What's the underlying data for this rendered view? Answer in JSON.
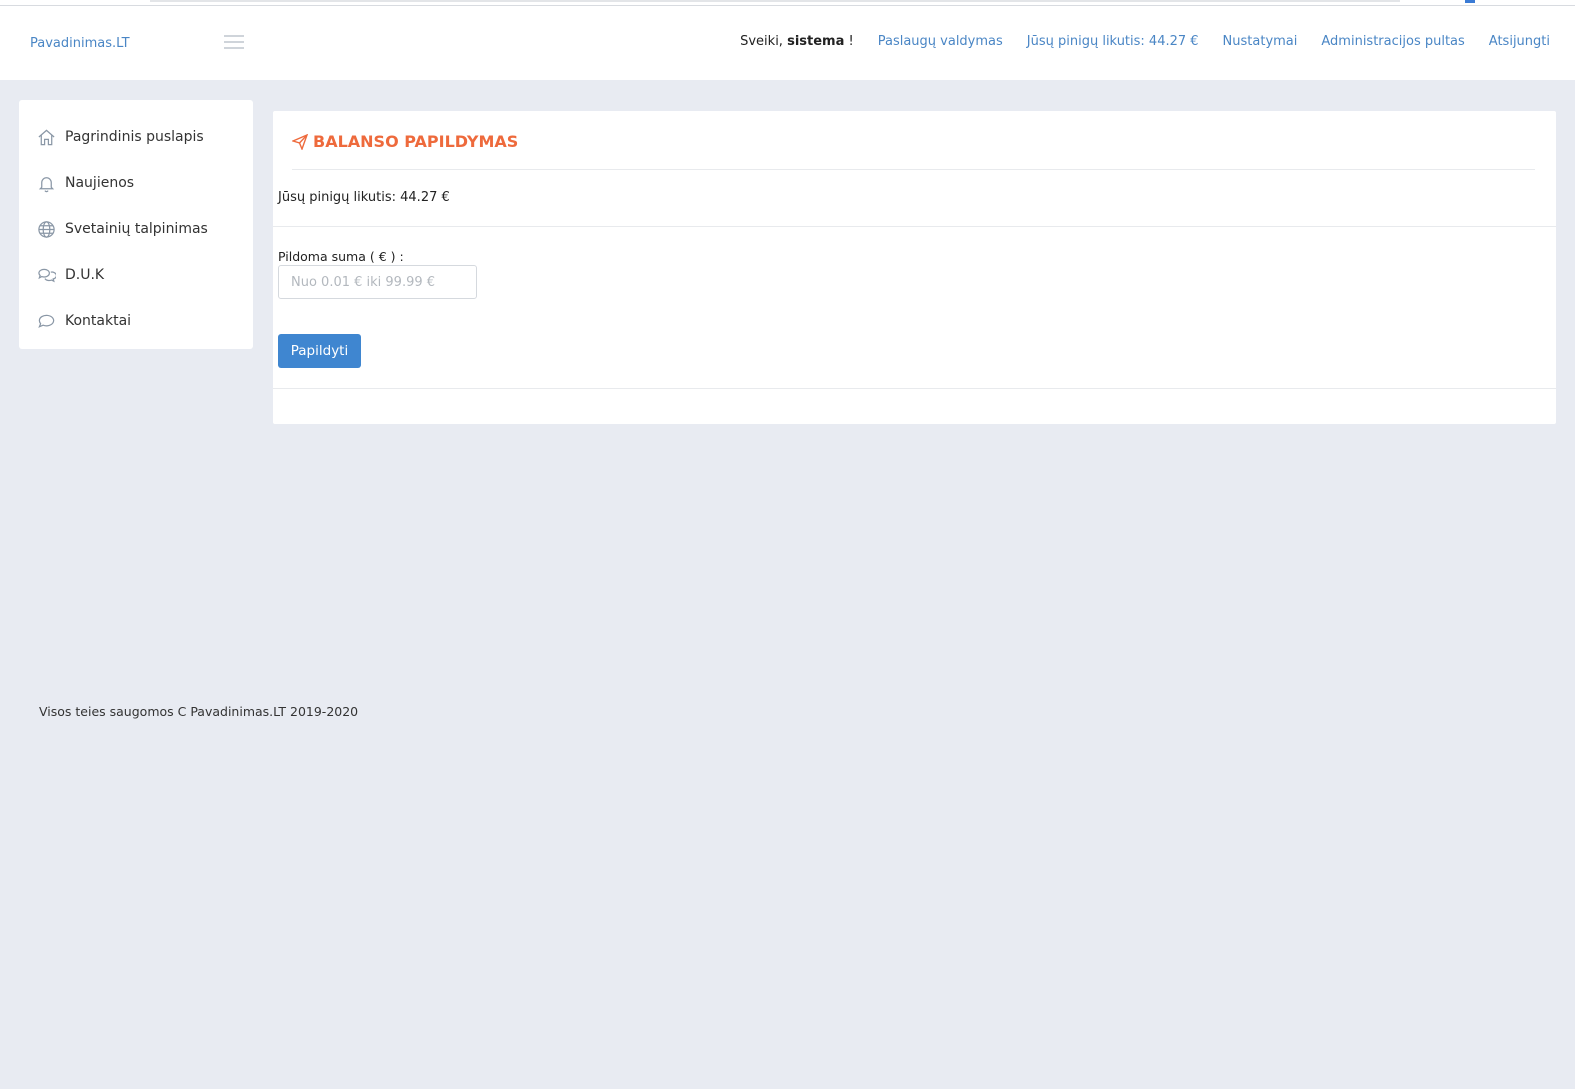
{
  "header": {
    "brand": "Pavadinimas.LT",
    "greeting_prefix": "Sveiki,",
    "greeting_user": "sistema",
    "greeting_suffix": "!",
    "nav": [
      {
        "label": "Paslaugų valdymas"
      },
      {
        "label": "Jūsų pinigų likutis: 44.27 €"
      },
      {
        "label": "Nustatymai"
      },
      {
        "label": "Administracijos pultas"
      },
      {
        "label": "Atsijungti"
      }
    ]
  },
  "sidebar": {
    "items": [
      {
        "label": "Pagrindinis puslapis",
        "icon": "home-icon"
      },
      {
        "label": "Naujienos",
        "icon": "bell-icon"
      },
      {
        "label": "Svetainių talpinimas",
        "icon": "globe-icon"
      },
      {
        "label": "D.U.K",
        "icon": "chat-bubbles-icon"
      },
      {
        "label": "Kontaktai",
        "icon": "speech-bubble-icon"
      }
    ]
  },
  "panel": {
    "title": "BALANSO PAPILDYMAS",
    "balance_text": "Jūsų pinigų likutis: 44.27 €",
    "amount_label": "Pildoma suma ( € ) :",
    "amount_placeholder": "Nuo 0.01 € iki 99.99 €",
    "amount_value": "",
    "submit_label": "Papildyti"
  },
  "footer": {
    "text": "Visos teies saugomos C Pavadinimas.LT 2019-2020"
  },
  "colors": {
    "accent": "#ee6a3c",
    "link": "#4a86c5",
    "button": "#3f86d0",
    "background": "#e8ebf2"
  }
}
